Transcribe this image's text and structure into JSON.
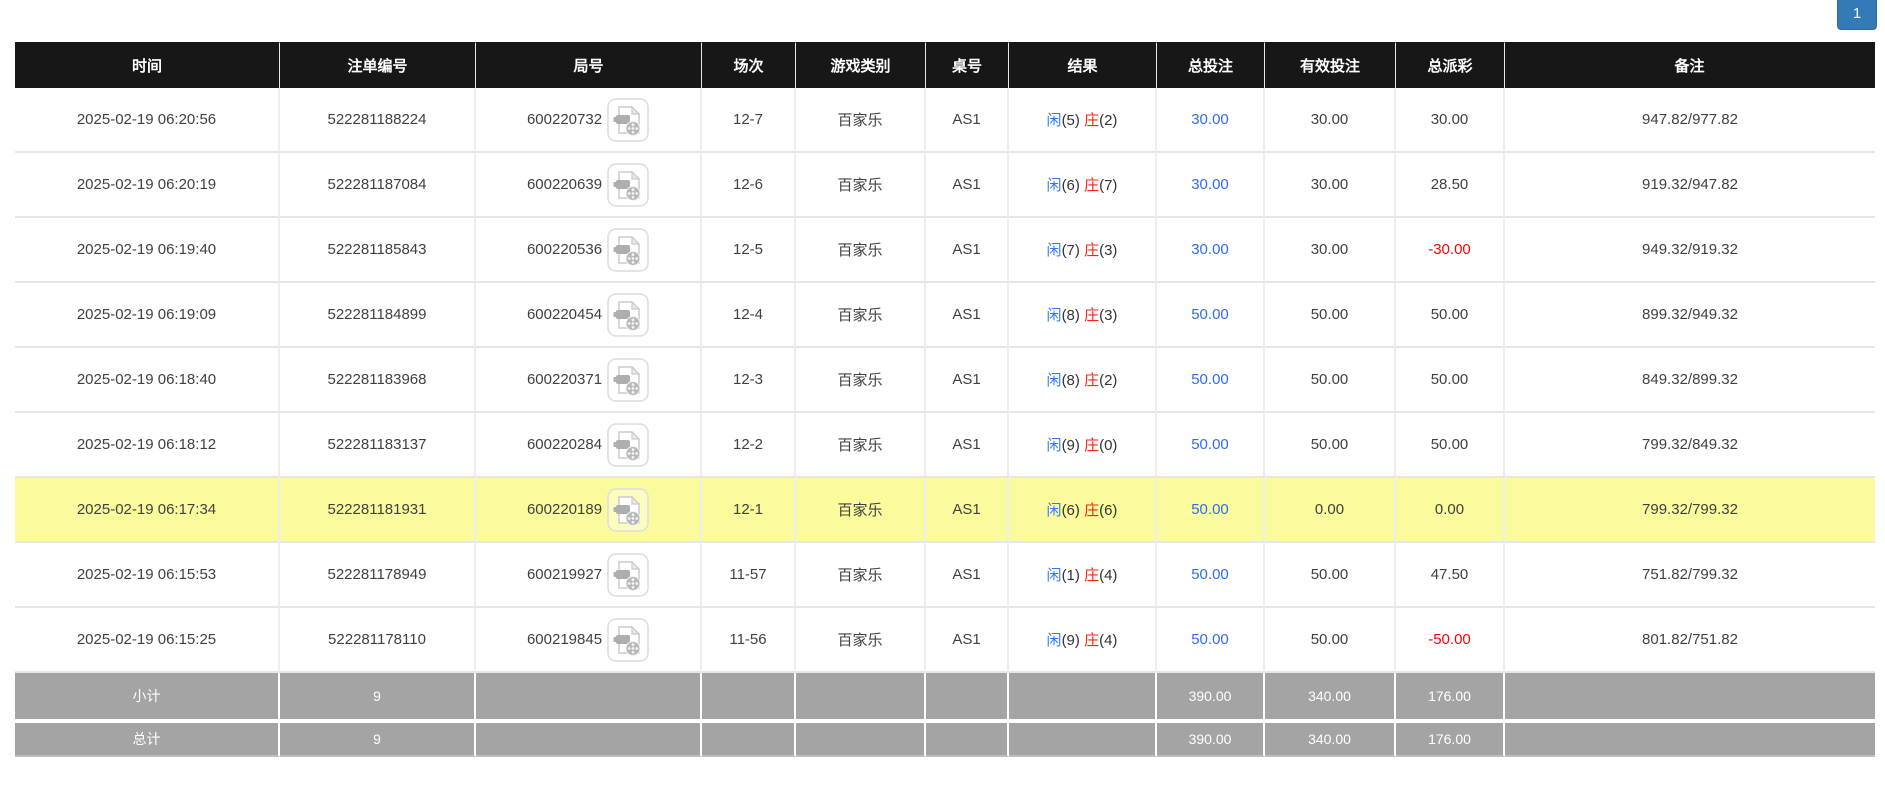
{
  "pagination": {
    "current_page": "1"
  },
  "table": {
    "headers": [
      "时间",
      "注单编号",
      "局号",
      "场次",
      "游戏类别",
      "桌号",
      "结果",
      "总投注",
      "有效投注",
      "总派彩",
      "备注"
    ],
    "rows": [
      {
        "time": "2025-02-19 06:20:56",
        "bet_no": "522281188224",
        "round_no": "600220732",
        "session": "12-7",
        "game": "百家乐",
        "table_no": "AS1",
        "result_player": "闲",
        "result_player_pts": "(5)",
        "result_banker": "庄",
        "result_banker_pts": "(2)",
        "total_bet": "30.00",
        "valid_bet": "30.00",
        "payout": "30.00",
        "remark": "947.82/977.82",
        "highlighted": false
      },
      {
        "time": "2025-02-19 06:20:19",
        "bet_no": "522281187084",
        "round_no": "600220639",
        "session": "12-6",
        "game": "百家乐",
        "table_no": "AS1",
        "result_player": "闲",
        "result_player_pts": "(6)",
        "result_banker": "庄",
        "result_banker_pts": "(7)",
        "total_bet": "30.00",
        "valid_bet": "30.00",
        "payout": "28.50",
        "remark": "919.32/947.82",
        "highlighted": false
      },
      {
        "time": "2025-02-19 06:19:40",
        "bet_no": "522281185843",
        "round_no": "600220536",
        "session": "12-5",
        "game": "百家乐",
        "table_no": "AS1",
        "result_player": "闲",
        "result_player_pts": "(7)",
        "result_banker": "庄",
        "result_banker_pts": "(3)",
        "total_bet": "30.00",
        "valid_bet": "30.00",
        "payout": "-30.00",
        "remark": "949.32/919.32",
        "highlighted": false
      },
      {
        "time": "2025-02-19 06:19:09",
        "bet_no": "522281184899",
        "round_no": "600220454",
        "session": "12-4",
        "game": "百家乐",
        "table_no": "AS1",
        "result_player": "闲",
        "result_player_pts": "(8)",
        "result_banker": "庄",
        "result_banker_pts": "(3)",
        "total_bet": "50.00",
        "valid_bet": "50.00",
        "payout": "50.00",
        "remark": "899.32/949.32",
        "highlighted": false
      },
      {
        "time": "2025-02-19 06:18:40",
        "bet_no": "522281183968",
        "round_no": "600220371",
        "session": "12-3",
        "game": "百家乐",
        "table_no": "AS1",
        "result_player": "闲",
        "result_player_pts": "(8)",
        "result_banker": "庄",
        "result_banker_pts": "(2)",
        "total_bet": "50.00",
        "valid_bet": "50.00",
        "payout": "50.00",
        "remark": "849.32/899.32",
        "highlighted": false
      },
      {
        "time": "2025-02-19 06:18:12",
        "bet_no": "522281183137",
        "round_no": "600220284",
        "session": "12-2",
        "game": "百家乐",
        "table_no": "AS1",
        "result_player": "闲",
        "result_player_pts": "(9)",
        "result_banker": "庄",
        "result_banker_pts": "(0)",
        "total_bet": "50.00",
        "valid_bet": "50.00",
        "payout": "50.00",
        "remark": "799.32/849.32",
        "highlighted": false
      },
      {
        "time": "2025-02-19 06:17:34",
        "bet_no": "522281181931",
        "round_no": "600220189",
        "session": "12-1",
        "game": "百家乐",
        "table_no": "AS1",
        "result_player": "闲",
        "result_player_pts": "(6)",
        "result_banker": "庄",
        "result_banker_pts": "(6)",
        "total_bet": "50.00",
        "valid_bet": "0.00",
        "payout": "0.00",
        "remark": "799.32/799.32",
        "highlighted": true
      },
      {
        "time": "2025-02-19 06:15:53",
        "bet_no": "522281178949",
        "round_no": "600219927",
        "session": "11-57",
        "game": "百家乐",
        "table_no": "AS1",
        "result_player": "闲",
        "result_player_pts": "(1)",
        "result_banker": "庄",
        "result_banker_pts": "(4)",
        "total_bet": "50.00",
        "valid_bet": "50.00",
        "payout": "47.50",
        "remark": "751.82/799.32",
        "highlighted": false
      },
      {
        "time": "2025-02-19 06:15:25",
        "bet_no": "522281178110",
        "round_no": "600219845",
        "session": "11-56",
        "game": "百家乐",
        "table_no": "AS1",
        "result_player": "闲",
        "result_player_pts": "(9)",
        "result_banker": "庄",
        "result_banker_pts": "(4)",
        "total_bet": "50.00",
        "valid_bet": "50.00",
        "payout": "-50.00",
        "remark": "801.82/751.82",
        "highlighted": false
      }
    ],
    "summary": [
      {
        "label": "小计",
        "count": "9",
        "total_bet": "390.00",
        "valid_bet": "340.00",
        "payout": "176.00"
      },
      {
        "label": "总计",
        "count": "9",
        "total_bet": "390.00",
        "valid_bet": "340.00",
        "payout": "176.00"
      }
    ]
  },
  "icons": {
    "video_icon": "video-playback-icon"
  },
  "colors": {
    "header_bg": "#171717",
    "player_blue": "#3377ff",
    "banker_red": "#ff2216",
    "amount_link_blue": "#2f6bf0",
    "negative_red": "#ff0000",
    "highlight_yellow": "#fbfb9e",
    "summary_gray": "#a4a4a4",
    "pagination_blue": "#337ab7"
  }
}
